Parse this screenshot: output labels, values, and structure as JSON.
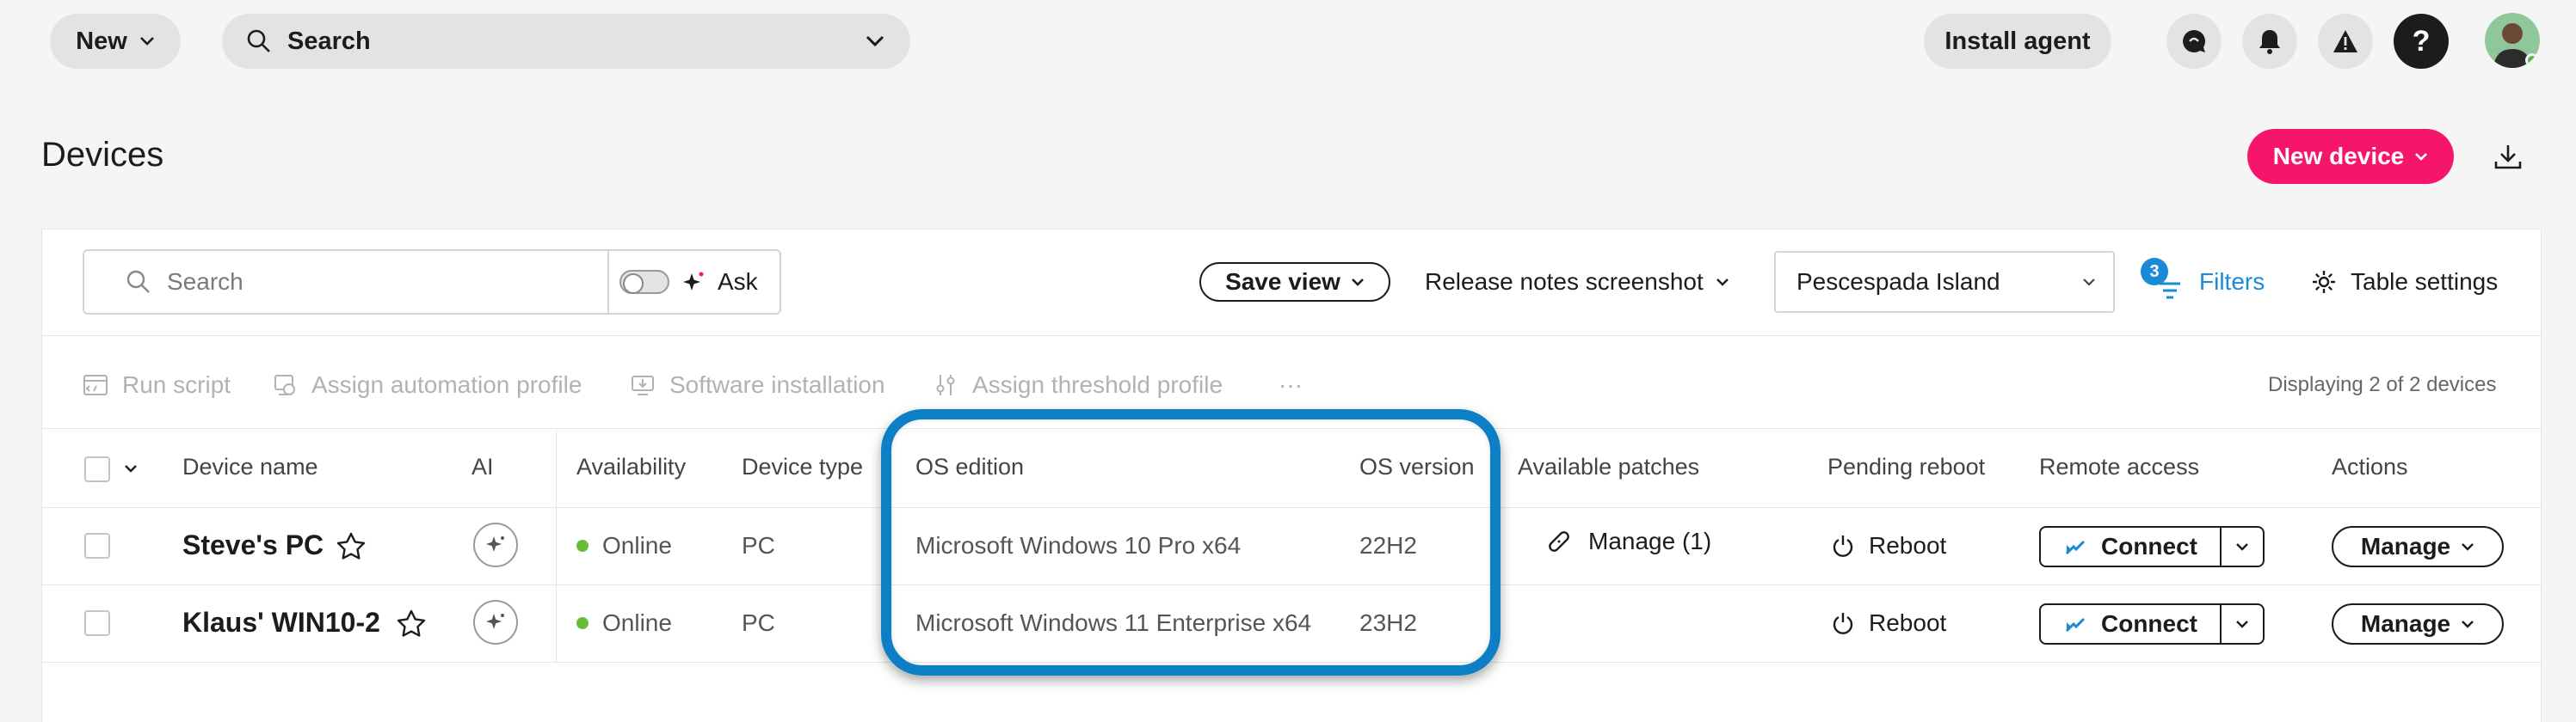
{
  "topbar": {
    "new_label": "New",
    "search_label": "Search",
    "install_label": "Install agent",
    "help_glyph": "?"
  },
  "page": {
    "title": "Devices",
    "new_device_label": "New device"
  },
  "toolbar": {
    "search_placeholder": "Search",
    "ask_label": "Ask",
    "save_view_label": "Save view",
    "view_name": "Release notes screenshot",
    "site_value": "Pescespada Island",
    "filters_count": "3",
    "filters_label": "Filters",
    "table_settings_label": "Table settings"
  },
  "bulk_actions": {
    "run_script": "Run script",
    "assign_automation": "Assign automation profile",
    "software_installation": "Software installation",
    "assign_threshold": "Assign threshold profile",
    "more": "···",
    "displaying": "Displaying 2 of 2 devices"
  },
  "table": {
    "columns": {
      "device_name": "Device name",
      "ai": "AI",
      "availability": "Availability",
      "device_type": "Device type",
      "os_edition": "OS edition",
      "os_version": "OS version",
      "available_patches": "Available patches",
      "pending_reboot": "Pending reboot",
      "remote_access": "Remote access",
      "actions": "Actions"
    },
    "rows": [
      {
        "device_name": "Steve's PC",
        "availability": "Online",
        "device_type": "PC",
        "os_edition": "Microsoft Windows 10 Pro x64",
        "os_version": "22H2",
        "patches": "Manage (1)",
        "pending_reboot": "Reboot",
        "remote_access": "Connect",
        "actions": "Manage"
      },
      {
        "device_name": "Klaus' WIN10-2",
        "availability": "Online",
        "device_type": "PC",
        "os_edition": "Microsoft Windows 11 Enterprise x64",
        "os_version": "23H2",
        "patches": "",
        "pending_reboot": "Reboot",
        "remote_access": "Connect",
        "actions": "Manage"
      }
    ]
  },
  "colors": {
    "accent_pink": "#f5166b",
    "accent_blue": "#1a8ad6",
    "highlight_border": "#0d7fc4",
    "online_green": "#6bbb3a"
  }
}
